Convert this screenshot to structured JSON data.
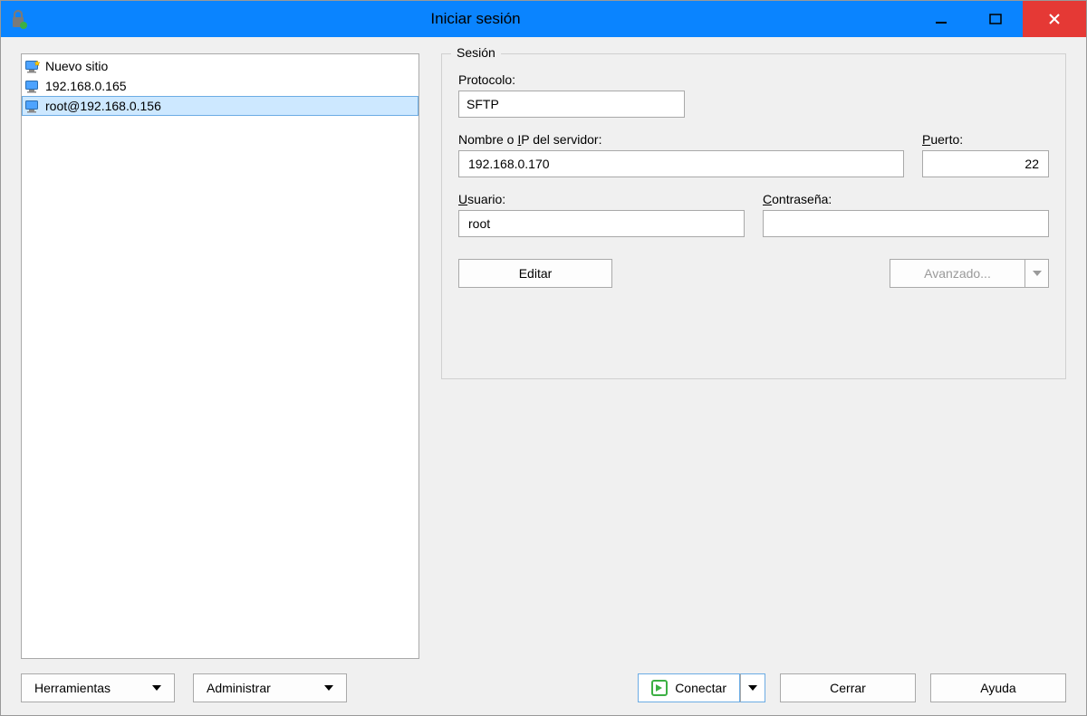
{
  "window": {
    "title": "Iniciar sesión"
  },
  "sites": [
    {
      "label": "Nuevo sitio",
      "selected": false,
      "new": true
    },
    {
      "label": "192.168.0.165",
      "selected": false,
      "new": false
    },
    {
      "label": "root@192.168.0.156",
      "selected": true,
      "new": false
    }
  ],
  "session": {
    "legend": "Sesión",
    "protocol_label": "Protocolo:",
    "protocol_value": "SFTP",
    "host_label": "Nombre o IP del servidor:",
    "host_underline_index": 9,
    "host_value": "192.168.0.170",
    "port_label": "Puerto:",
    "port_underline_index": 0,
    "port_value": "22",
    "user_label": "Usuario:",
    "user_underline_index": 0,
    "user_value": "root",
    "password_label": "Contraseña:",
    "password_underline_index": 0,
    "password_value": "",
    "edit_button": "Editar",
    "advanced_button": "Avanzado..."
  },
  "footer": {
    "tools_button": "Herramientas",
    "manage_button": "Administrar",
    "connect_button": "Conectar",
    "close_button": "Cerrar",
    "help_button": "Ayuda"
  }
}
